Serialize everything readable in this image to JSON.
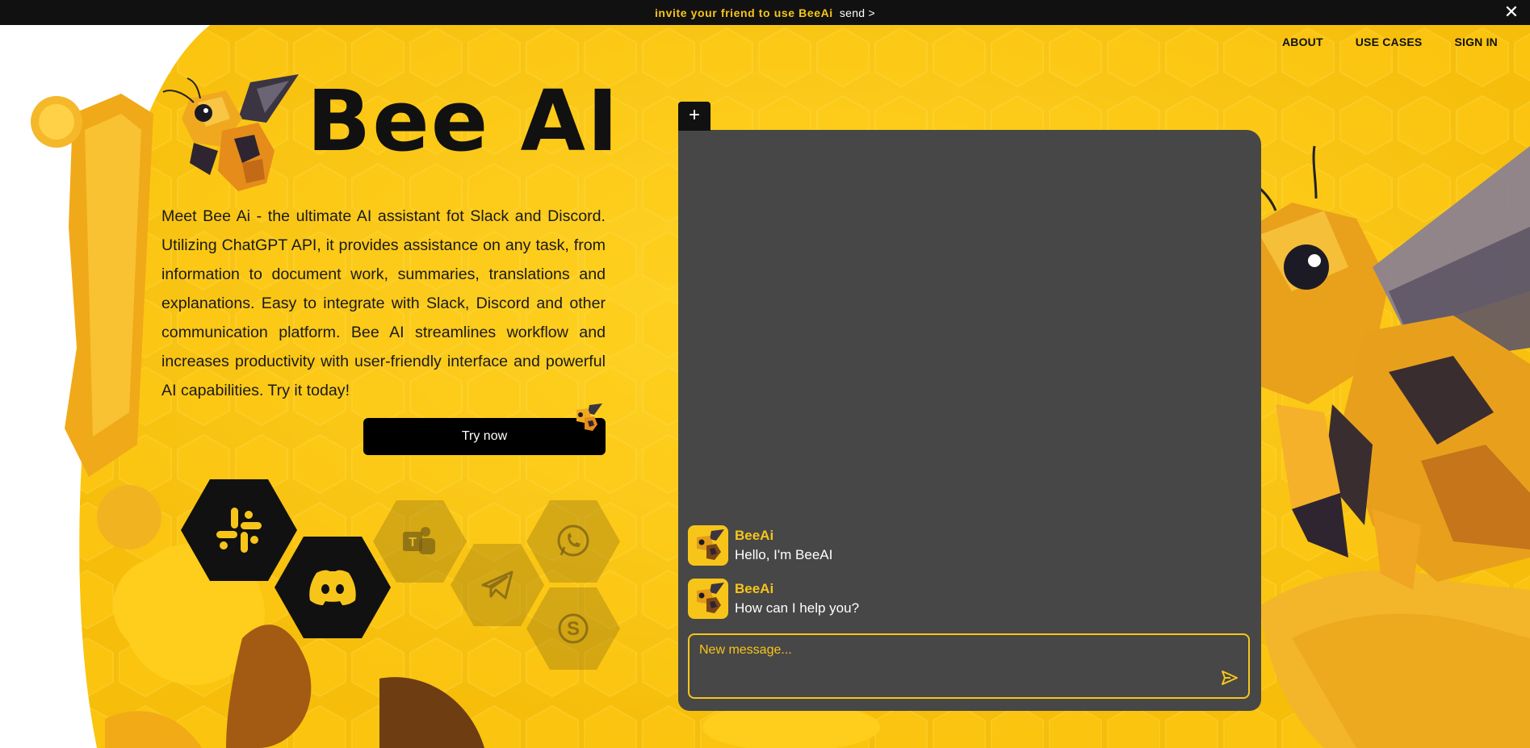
{
  "banner": {
    "invite_text": "invite your friend to use BeeAi",
    "send_label": "send >",
    "close_icon": "close-icon"
  },
  "nav": {
    "about": "ABOUT",
    "use_cases": "USE CASES",
    "sign_in": "SIGN IN"
  },
  "hero": {
    "title": "Bee AI",
    "description": "Meet Bee Ai - the ultimate AI assistant fot Slack and Discord. Utilizing ChatGPT API, it provides assistance on any task, from information to document work, summaries, translations and explanations. Easy to integrate with Slack, Discord and other communication platform. Bee AI streamlines workflow and increases productivity with user-friendly interface and powerful AI capabilities. Try it today!",
    "cta_label": "Try now"
  },
  "platforms": [
    {
      "name": "Slack",
      "icon": "slack-icon",
      "active": true
    },
    {
      "name": "Discord",
      "icon": "discord-icon",
      "active": true
    },
    {
      "name": "Microsoft Teams",
      "icon": "teams-icon",
      "active": false
    },
    {
      "name": "Telegram",
      "icon": "telegram-icon",
      "active": false
    },
    {
      "name": "WhatsApp",
      "icon": "whatsapp-icon",
      "active": false
    },
    {
      "name": "Skype",
      "icon": "skype-icon",
      "active": false
    }
  ],
  "chat": {
    "add_label": "+",
    "messages": [
      {
        "sender": "BeeAi",
        "text": "Hello, I'm BeeAI"
      },
      {
        "sender": "BeeAi",
        "text": "How can I help you?"
      }
    ],
    "input_placeholder": "New message...",
    "input_value": ""
  },
  "colors": {
    "accent": "#f7c51a",
    "panel": "#474747",
    "dark": "#111111"
  }
}
